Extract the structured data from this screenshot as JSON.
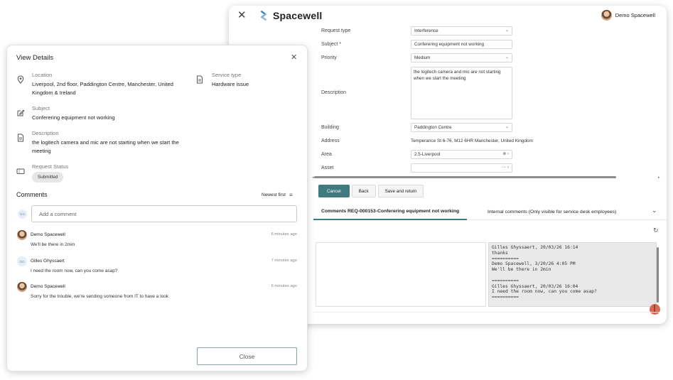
{
  "app": {
    "brand": "Spacewell",
    "close_glyph": "✕",
    "user_name": "Demo Spacewell"
  },
  "form": {
    "request_type_label": "Request type",
    "request_type_value": "Interference",
    "subject_label": "Subject *",
    "subject_value": "Conferering equipment not working",
    "priority_label": "Priority",
    "priority_value": "Medium",
    "description_label": "Description",
    "description_value": "the logitech camera and mic are not starting when we start the meeting",
    "building_label": "Building",
    "building_value": "Paddington Centre",
    "address_label": "Address",
    "address_value": "Temperance St 6-76, M12 6HR Manchester, United Kingdom",
    "area_label": "Area",
    "area_value": "2.5-Liverpool",
    "asset_label": "Asset",
    "asset_value": ""
  },
  "actions": {
    "cancel": "Cancel",
    "back": "Back",
    "save_return": "Save and return"
  },
  "comment_tabs": {
    "tab1": "Comments REQ-000153-Conferering equipment not working",
    "tab2": "Internal comments (Only visible for service desk employees)"
  },
  "comment_log": [
    "Gilles Ghyssaert, 20/03/26 16:14",
    "thanks",
    "==========",
    "Demo Spacewell, 3/20/26 4:05 PM",
    "We'll be there in 2min",
    "",
    "==========",
    "Gilles Ghyssaert, 20/03/26 16:04",
    "I need the room now, can you come asap?",
    "=========="
  ],
  "details": {
    "title": "View Details",
    "location_label": "Location",
    "location_value": "Liverpool, 2nd floor, Paddington Centre, Manchester, United Kingdom & Ireland",
    "service_label": "Service type",
    "service_value": "Hardware issue",
    "subject_label": "Subject",
    "subject_value": "Conferering equipment not working",
    "description_label": "Description",
    "description_value": "the logitech camera and mic are not starting when we start the meeting",
    "status_label": "Request Status",
    "status_value": "Submitted"
  },
  "comments": {
    "heading": "Comments",
    "sort_label": "Newest first",
    "add_initials": "GG",
    "add_placeholder": "Add a comment",
    "items": [
      {
        "name": "Demo Spacewell",
        "time": "6 minutes ago",
        "text": "We'll be there in 2min",
        "avatar": "photo",
        "initials": ""
      },
      {
        "name": "Gilles Ghyssaert",
        "time": "7 minutes ago",
        "text": "I need the room now, can you come asap?",
        "avatar": "initials",
        "initials": "GG"
      },
      {
        "name": "Demo Spacewell",
        "time": "6 minutes ago",
        "text": "Sorry for the trouble, we're sending someone from IT to have a look",
        "avatar": "photo",
        "initials": ""
      }
    ]
  },
  "footer": {
    "close_label": "Close"
  }
}
